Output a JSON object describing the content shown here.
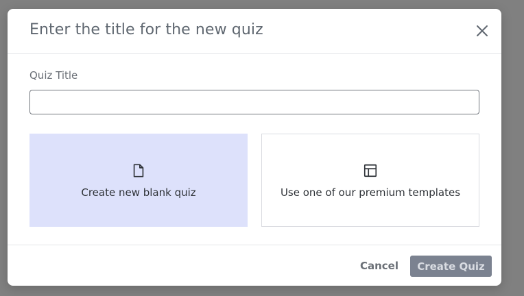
{
  "dialog": {
    "title": "Enter the title for the new quiz",
    "close_icon": "close-icon"
  },
  "form": {
    "label": "Quiz Title",
    "value": "",
    "placeholder": ""
  },
  "options": [
    {
      "label": "Create new blank quiz",
      "icon": "file-icon",
      "selected": true
    },
    {
      "label": "Use one of our premium templates",
      "icon": "layout-template-icon",
      "selected": false
    }
  ],
  "footer": {
    "cancel_label": "Cancel",
    "create_label": "Create Quiz"
  },
  "colors": {
    "backdrop": "#808080",
    "selected_card": "#dde1fb",
    "primary_disabled": "#7b8290"
  }
}
